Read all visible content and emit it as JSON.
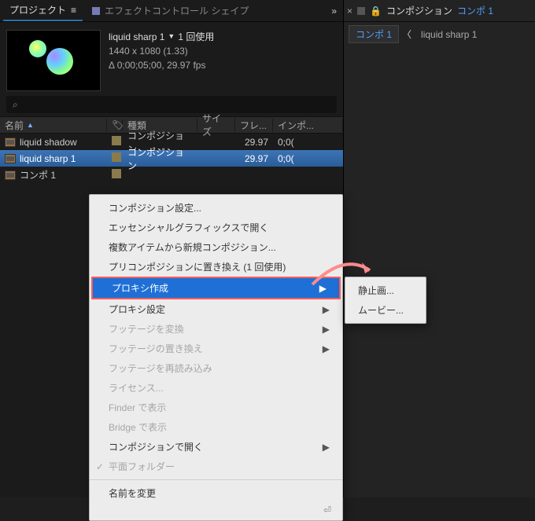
{
  "leftTabs": {
    "project": "プロジェクト",
    "effect": "エフェクトコントロール シェイプ"
  },
  "info": {
    "name": "liquid sharp 1",
    "usage": "1 回使用",
    "dims": "1440 x 1080 (1.33)",
    "tc": "Δ 0;00;05;00, 29.97 fps"
  },
  "listHeader": {
    "name": "名前",
    "type": "種類",
    "size": "サイズ",
    "fps": "フレ...",
    "import": "インポ..."
  },
  "rows": [
    {
      "name": "liquid shadow",
      "type": "コンポジション",
      "fps": "29.97",
      "extra": "0;0("
    },
    {
      "name": "liquid sharp 1",
      "type": "コンポジション",
      "fps": "29.97",
      "extra": "0;0("
    },
    {
      "name": "コンポ 1",
      "type": "",
      "fps": "",
      "extra": ""
    }
  ],
  "rightTabs": {
    "compLabel": "コンポジション",
    "compName": "コンポ 1"
  },
  "crumb": {
    "comp": "コンポ 1",
    "item": "liquid sharp 1"
  },
  "ctx": {
    "compSettings": "コンポジション設定...",
    "openEG": "エッセンシャルグラフィックスで開く",
    "newFromMulti": "複数アイテムから新規コンポジション...",
    "replacePrecomp": "プリコンポジションに置き換え (1 回使用)",
    "createProxy": "プロキシ作成",
    "setProxy": "プロキシ設定",
    "convertFootage": "フッテージを変換",
    "replaceFootage": "フッテージの置き換え",
    "reloadFootage": "フッテージを再読み込み",
    "license": "ライセンス...",
    "revealFinder": "Finder で表示",
    "revealBridge": "Bridge で表示",
    "openInComp": "コンポジションで開く",
    "solidFolder": "平面フォルダー",
    "rename": "名前を変更"
  },
  "ctx2": {
    "still": "静止画...",
    "movie": "ムービー..."
  }
}
